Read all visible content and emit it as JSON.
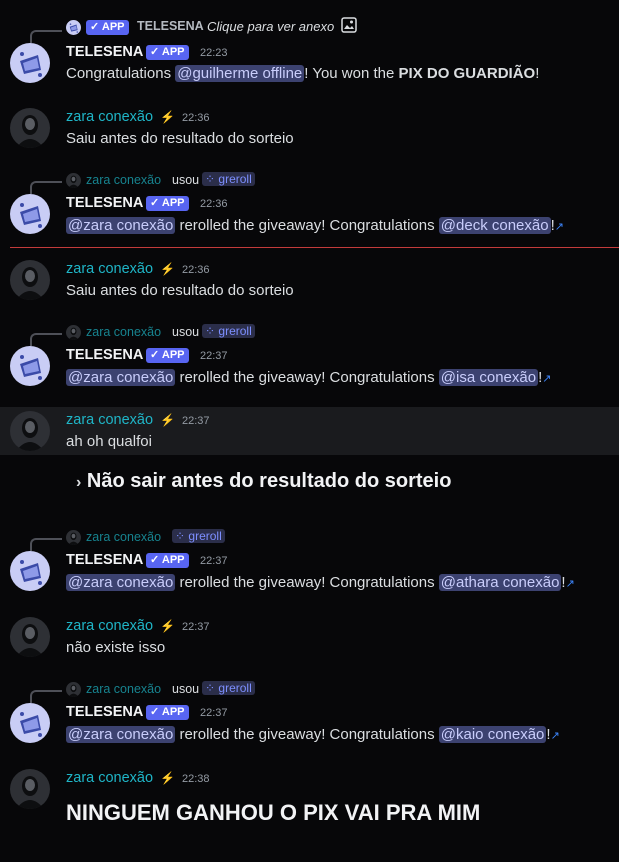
{
  "messages": {
    "m1": {
      "reply_name": "TELESENA",
      "reply_badge": "APP",
      "reply_text": "Clique para ver anexo",
      "author": "TELESENA",
      "badge": "APP",
      "time": "22:23",
      "t1": "Congratulations ",
      "mention": "@guilherme offline",
      "t2": "! You won the ",
      "bold": "PIX DO GUARDIÃO",
      "t3": "!"
    },
    "m2": {
      "author": "zara conexão",
      "time": "22:36",
      "text": "Saiu antes do resultado do sorteio"
    },
    "m3": {
      "reply_name": "zara conexão",
      "reply_used": "usou",
      "reply_cmd": "greroll",
      "author": "TELESENA",
      "badge": "APP",
      "time": "22:36",
      "mention1": "@zara conexão",
      "t1": " rerolled the giveaway! Congratulations ",
      "mention2": "@deck conexão",
      "t2": "!"
    },
    "m4": {
      "author": "zara conexão",
      "time": "22:36",
      "text": "Saiu antes do resultado do sorteio"
    },
    "m5": {
      "reply_name": "zara conexão",
      "reply_used": "usou",
      "reply_cmd": "greroll",
      "author": "TELESENA",
      "badge": "APP",
      "time": "22:37",
      "mention1": "@zara conexão",
      "t1": " rerolled the giveaway! Congratulations ",
      "mention2": "@isa conexão",
      "t2": "!"
    },
    "m6": {
      "author": "zara conexão",
      "time": "22:37",
      "text": "ah oh qualfoi",
      "heading": "Não sair antes do resultado do sorteio"
    },
    "m7": {
      "reply_name": "zara conexão",
      "reply_cmd": "greroll",
      "author": "TELESENA",
      "badge": "APP",
      "time": "22:37",
      "mention1": "@zara conexão",
      "t1": " rerolled the giveaway! Congratulations ",
      "mention2": "@athara conexão",
      "t2": "!"
    },
    "m8": {
      "author": "zara conexão",
      "time": "22:37",
      "text": "não existe isso"
    },
    "m9": {
      "reply_name": "zara conexão",
      "reply_used": "usou",
      "reply_cmd": "greroll",
      "author": "TELESENA",
      "badge": "APP",
      "time": "22:37",
      "mention1": "@zara conexão",
      "t1": " rerolled the giveaway! Congratulations ",
      "mention2": "@kaio conexão",
      "t2": "!"
    },
    "m10": {
      "author": "zara conexão",
      "time": "22:38",
      "text": "NINGUEM GANHOU O PIX VAI PRA MIM"
    }
  },
  "icons": {
    "check": "✓",
    "external": "↗",
    "slash": "⚡",
    "cmd": "⁘",
    "image": "image-icon",
    "bullet": "⁘"
  },
  "colors": {
    "background": "#070709",
    "mention_bg": "#3c4270",
    "app_badge": "#5865f2",
    "username": "#1fb5c7",
    "divider": "#c33b3b"
  }
}
